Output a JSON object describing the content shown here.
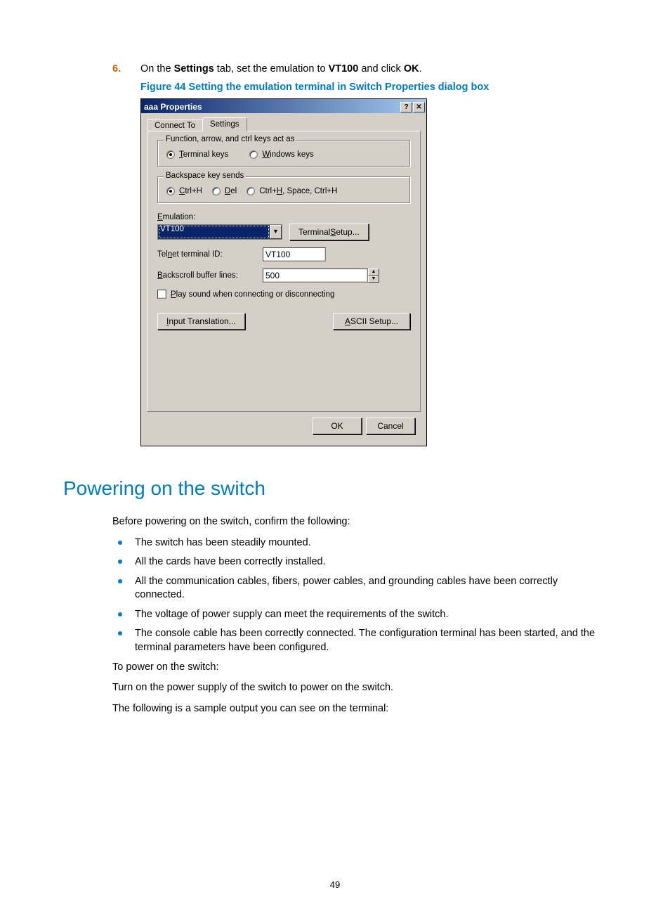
{
  "step": {
    "number": "6.",
    "text_prefix": "On the ",
    "bold1": "Settings",
    "text_mid1": " tab, set the emulation to ",
    "bold2": "VT100",
    "text_mid2": " and click ",
    "bold3": "OK",
    "text_suffix": "."
  },
  "figure_caption": "Figure 44 Setting the emulation terminal in Switch Properties dialog box",
  "dialog": {
    "title": "aaa Properties",
    "tab_connect": "Connect To",
    "tab_settings": "Settings",
    "fieldset1_legend": "Function, arrow, and ctrl keys act as",
    "radio_terminal": "Terminal keys",
    "radio_windows": "Windows keys",
    "fieldset2_legend": "Backspace key sends",
    "radio_ctrlh": "Ctrl+H",
    "radio_del": "Del",
    "radio_ctrlhspace": "Ctrl+H, Space, Ctrl+H",
    "emulation_label": "Emulation:",
    "emulation_value": "VT100",
    "terminal_setup_btn": "Terminal Setup...",
    "telnet_label": "Telnet terminal ID:",
    "telnet_value": "VT100",
    "backscroll_label": "Backscroll buffer lines:",
    "backscroll_value": "500",
    "playsound_label": "Play sound when connecting or disconnecting",
    "input_translation_btn": "Input Translation...",
    "ascii_setup_btn": "ASCII Setup...",
    "ok_btn": "OK",
    "cancel_btn": "Cancel"
  },
  "heading": "Powering on the switch",
  "intro": "Before powering on the switch, confirm the following:",
  "bullets": [
    "The switch has been steadily mounted.",
    "All the cards have been correctly installed.",
    "All the communication cables, fibers, power cables, and grounding cables have been correctly connected.",
    "The voltage of power supply can meet the requirements of the switch.",
    "The console cable has been correctly connected. The configuration terminal has been started, and the terminal parameters have been configured."
  ],
  "p1": "To power on the switch:",
  "p2": "Turn on the power supply of the switch to power on the switch.",
  "p3": "The following is a sample output you can see on the terminal:",
  "page_number": "49"
}
